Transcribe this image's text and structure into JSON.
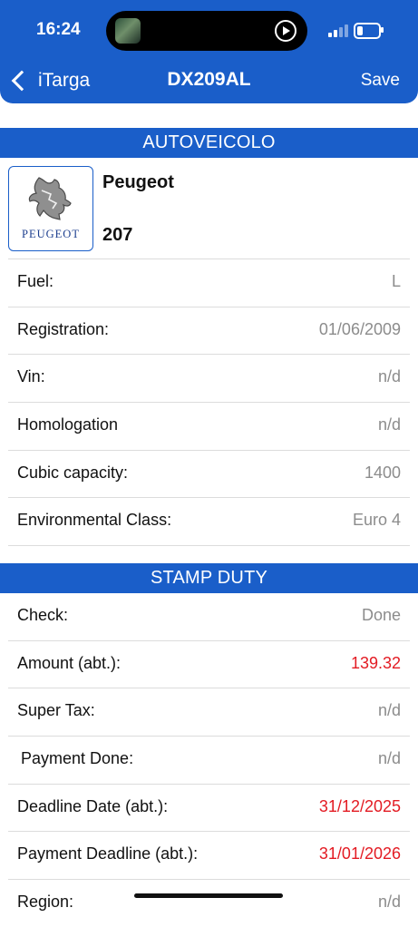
{
  "status_bar": {
    "time": "16:24"
  },
  "nav": {
    "back_label": "iTarga",
    "title": "DX209AL",
    "save_label": "Save"
  },
  "vehicle_section": {
    "header": "AUTOVEICOLO",
    "make": "Peugeot",
    "model": "207",
    "logo_text": "PEUGEOT",
    "rows": [
      {
        "label": "Fuel:",
        "value": "L"
      },
      {
        "label": "Registration:",
        "value": "01/06/2009"
      },
      {
        "label": "Vin:",
        "value": "n/d"
      },
      {
        "label": "Homologation",
        "value": "n/d"
      },
      {
        "label": "Cubic capacity:",
        "value": "1400"
      },
      {
        "label": "Environmental Class:",
        "value": "Euro 4"
      }
    ]
  },
  "stamp_section": {
    "header": "STAMP DUTY",
    "rows": [
      {
        "label": "Check:",
        "value": "Done"
      },
      {
        "label": "Amount (abt.):",
        "value": "139.32"
      },
      {
        "label": "Super Tax:",
        "value": "n/d"
      },
      {
        "label": "Payment Done:",
        "value": "n/d"
      },
      {
        "label": "Deadline Date (abt.):",
        "value": "31/12/2025"
      },
      {
        "label": "Payment Deadline (abt.):",
        "value": "31/01/2026"
      },
      {
        "label": "Region:",
        "value": "n/d"
      }
    ]
  },
  "colors": {
    "accent": "#1a5ec9",
    "value_grey": "#8c8c8c",
    "value_red": "#e31b23"
  }
}
